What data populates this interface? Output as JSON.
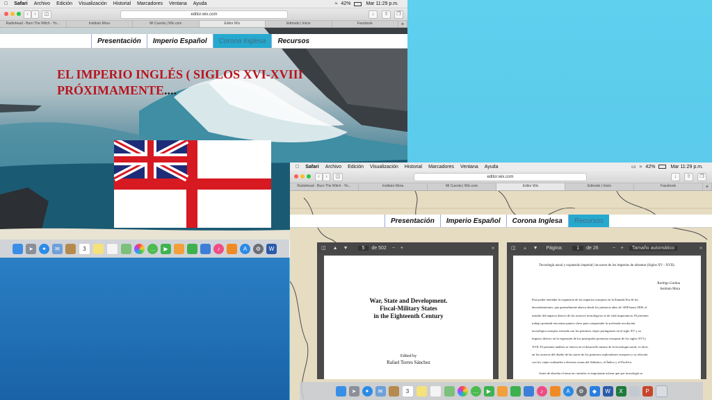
{
  "menubar": {
    "app": "Safari",
    "items": [
      "Archivo",
      "Edición",
      "Visualización",
      "Historial",
      "Marcadores",
      "Ventana",
      "Ayuda"
    ],
    "battery": "42%",
    "clock": "Mar 11:29 p.m."
  },
  "browser": {
    "url": "editor.wix.com",
    "tabs": [
      "Radiohead - Burn The Witch - Yo...",
      "Instituto Mora",
      "Mi Cuenta | Wix.com",
      "Editor Wix",
      "Edmodo | Inicio",
      "Facebook"
    ],
    "active_tab": "Editor Wix"
  },
  "site_nav": {
    "items": [
      "Presentación",
      "Imperio Español",
      "Corona Inglesa",
      "Recursos"
    ]
  },
  "page": {
    "heading_line1": "EL IMPERIO INGLÉS ( SIGLOS XVI-XVIII",
    "heading_line2": "PRÓXIMAMENTE",
    "heading_ellipsis": "...."
  },
  "pdf_left": {
    "page_current": "5",
    "page_total": "de 502",
    "title_line1": "War, State and Development.",
    "title_line2": "Fiscal-Military States",
    "title_line3": "in the Eighteenth Century",
    "edited_by": "Edited by",
    "editor": "Rafael Torres Sánchez"
  },
  "pdf_right": {
    "page_label": "Página:",
    "page_current": "1",
    "page_total": "de 26",
    "zoom": "Tamaño automático",
    "doc_title": "Tecnología naval y expansión imperial; las naves de los imperios de ultramar (Siglos XV - XVII).",
    "author": "Rodrigo Gordoa",
    "institution": "Instituto Mora",
    "body": [
      "Para poder entender la expansión de los imperios europeos en la llamada Era de los",
      "descubrimientos, que generalmente abarca desde los primeros años de 1400 hasta 1800, el",
      "estudio del impacto directo de los avances tecnológicos es de vital importancia. El presente",
      "trabajo pretende encontrar puntos clave para comprender la acelerada revolución",
      "tecnológica europea, iniciada con los primeros viajes portugueses en el siglo XV y su",
      "impacto directo en la expansión de los principales potencias europeas de los siglos XVI y",
      "XVII. El presente análisis se enfoca en el desarrollo mismo de la tecnología naval, es decir,",
      "en los avances del diseño de las naves de los primeros exploradores europeos y su relación",
      "con los viajes realizados a diversas zonas del Atlántico, el Índico y el Pacífico."
    ],
    "last_line": "Antes de abordar el tema en cuestión, es importante aclarar que por tecnología se"
  },
  "dock": {
    "icons": [
      "finder-icon",
      "launchpad-icon",
      "safari-icon",
      "mail-icon",
      "contacts-icon",
      "calendar-icon",
      "notes-icon",
      "reminders-icon",
      "maps-icon",
      "photos-icon",
      "messages-icon",
      "facetime-icon",
      "pages-icon",
      "numbers-icon",
      "keynote-icon",
      "itunes-icon",
      "ibooks-icon",
      "appstore-icon",
      "system-preferences-icon",
      "word-icon"
    ],
    "calendar_day": "3"
  }
}
